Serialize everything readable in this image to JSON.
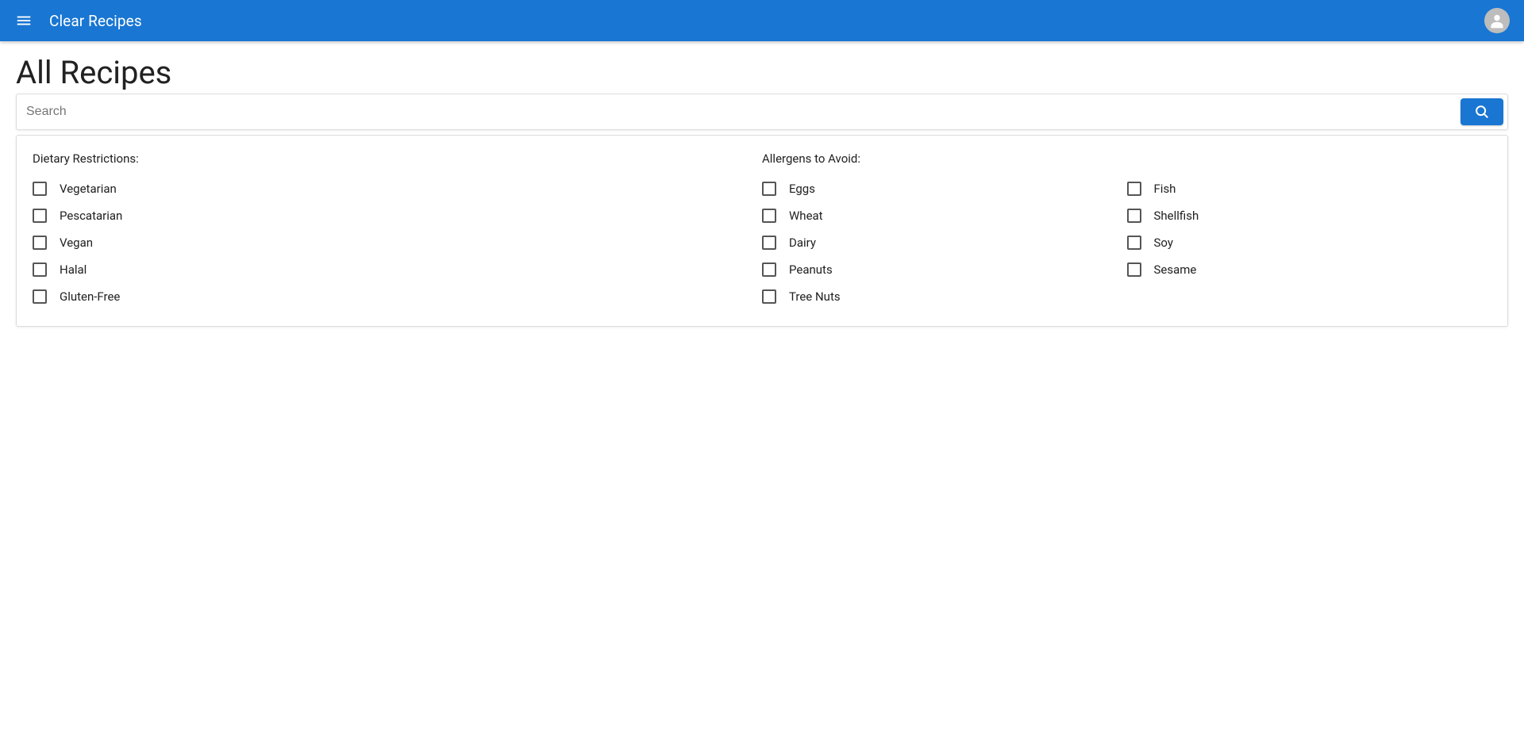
{
  "appbar": {
    "title": "Clear Recipes"
  },
  "page": {
    "title": "All Recipes"
  },
  "search": {
    "placeholder": "Search",
    "value": ""
  },
  "filters": {
    "dietary": {
      "heading": "Dietary Restrictions:",
      "items": [
        {
          "label": "Vegetarian"
        },
        {
          "label": "Pescatarian"
        },
        {
          "label": "Vegan"
        },
        {
          "label": "Halal"
        },
        {
          "label": "Gluten-Free"
        }
      ]
    },
    "allergens": {
      "heading": "Allergens to Avoid:",
      "col1": [
        {
          "label": "Eggs"
        },
        {
          "label": "Wheat"
        },
        {
          "label": "Dairy"
        },
        {
          "label": "Peanuts"
        },
        {
          "label": "Tree Nuts"
        }
      ],
      "col2": [
        {
          "label": "Fish"
        },
        {
          "label": "Shellfish"
        },
        {
          "label": "Soy"
        },
        {
          "label": "Sesame"
        }
      ]
    }
  }
}
